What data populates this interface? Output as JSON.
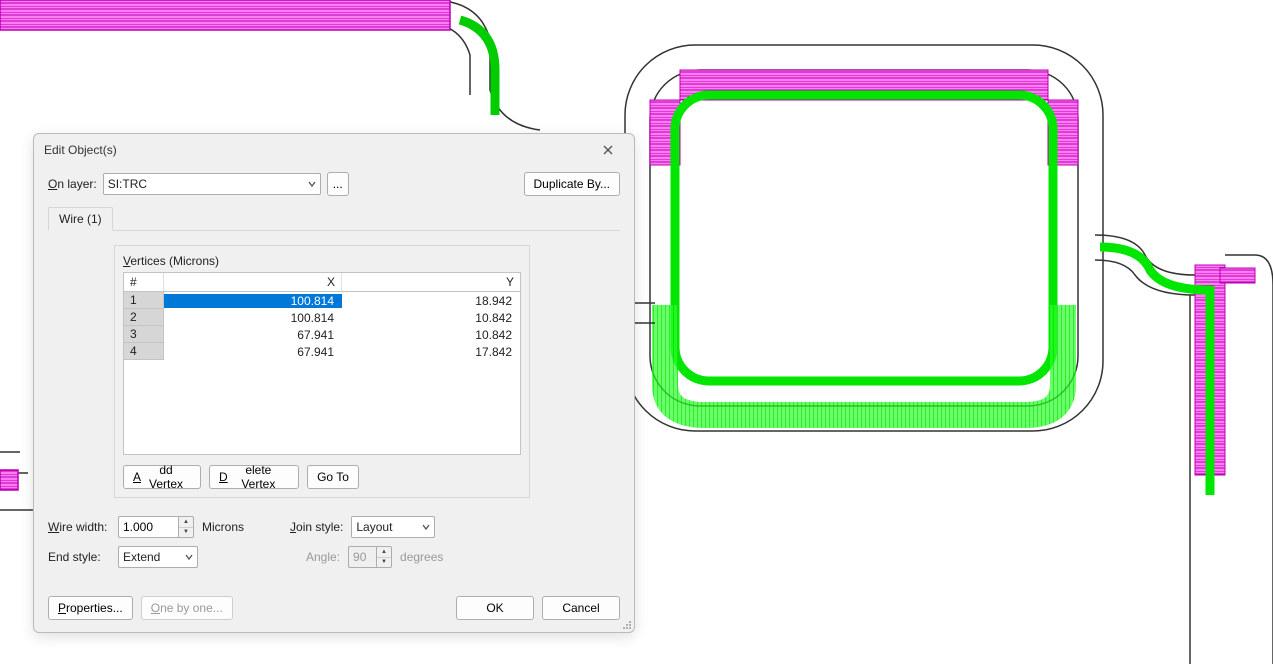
{
  "dialog": {
    "title": "Edit Object(s)",
    "on_layer_label_pre": "O",
    "on_layer_label_post": "n layer:",
    "layer_value": "SI:TRC",
    "ellipsis": "...",
    "duplicate_label": "Duplicate By...",
    "tab_label": "Wire (1)",
    "vertices_caption_pre": "V",
    "vertices_caption_post": "ertices (Microns)",
    "col_idx": "#",
    "col_x": "X",
    "col_y": "Y",
    "rows": [
      {
        "i": "1",
        "x": "100.814",
        "y": "18.942"
      },
      {
        "i": "2",
        "x": "100.814",
        "y": "10.842"
      },
      {
        "i": "3",
        "x": "67.941",
        "y": "10.842"
      },
      {
        "i": "4",
        "x": "67.941",
        "y": "17.842"
      }
    ],
    "add_vertex_pre": "A",
    "add_vertex_post": "dd Vertex",
    "del_vertex_pre": "D",
    "del_vertex_post": "elete Vertex",
    "goto": "Go To",
    "wire_width_pre": "W",
    "wire_width_post": "ire width:",
    "wire_width_val": "1.000",
    "microns": "Microns",
    "join_style_pre": "J",
    "join_style_post": "oin style:",
    "join_style_val": "Layout",
    "end_style_label": "End style:",
    "end_style_val": "Extend",
    "angle_label": "Angle:",
    "angle_val": "90",
    "degrees": "degrees",
    "properties_pre": "P",
    "properties_post": "roperties...",
    "one_by_one_pre": "O",
    "one_by_one_post": "ne by one...",
    "ok": "OK",
    "cancel": "Cancel"
  }
}
